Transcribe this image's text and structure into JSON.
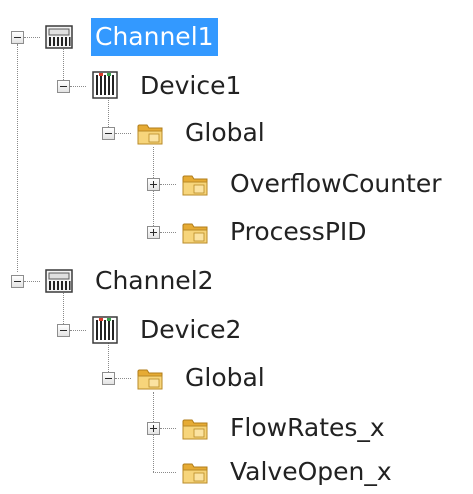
{
  "tree": {
    "nodes": [
      {
        "label": "Channel1",
        "icon": "channel-icon",
        "toggle": "minus",
        "selected": true
      },
      {
        "label": "Device1",
        "icon": "device-icon",
        "toggle": "minus"
      },
      {
        "label": "Global",
        "icon": "folder-icon",
        "toggle": "minus"
      },
      {
        "label": "OverflowCounter",
        "icon": "folder-icon",
        "toggle": "plus"
      },
      {
        "label": "ProcessPID",
        "icon": "folder-icon",
        "toggle": "plus"
      },
      {
        "label": "Channel2",
        "icon": "channel-icon",
        "toggle": "minus"
      },
      {
        "label": "Device2",
        "icon": "device-icon",
        "toggle": "minus"
      },
      {
        "label": "Global",
        "icon": "folder-icon",
        "toggle": "minus"
      },
      {
        "label": "FlowRates_x",
        "icon": "folder-icon",
        "toggle": "plus"
      },
      {
        "label": "ValveOpen_x",
        "icon": "folder-icon",
        "toggle": "none"
      }
    ]
  },
  "colors": {
    "selection": "#3399ff",
    "folder": "#f2c14e",
    "channel_icon": "#4a4a4a",
    "device_icon_led_red": "#d83a2a",
    "device_icon_led_green": "#37a24a"
  }
}
